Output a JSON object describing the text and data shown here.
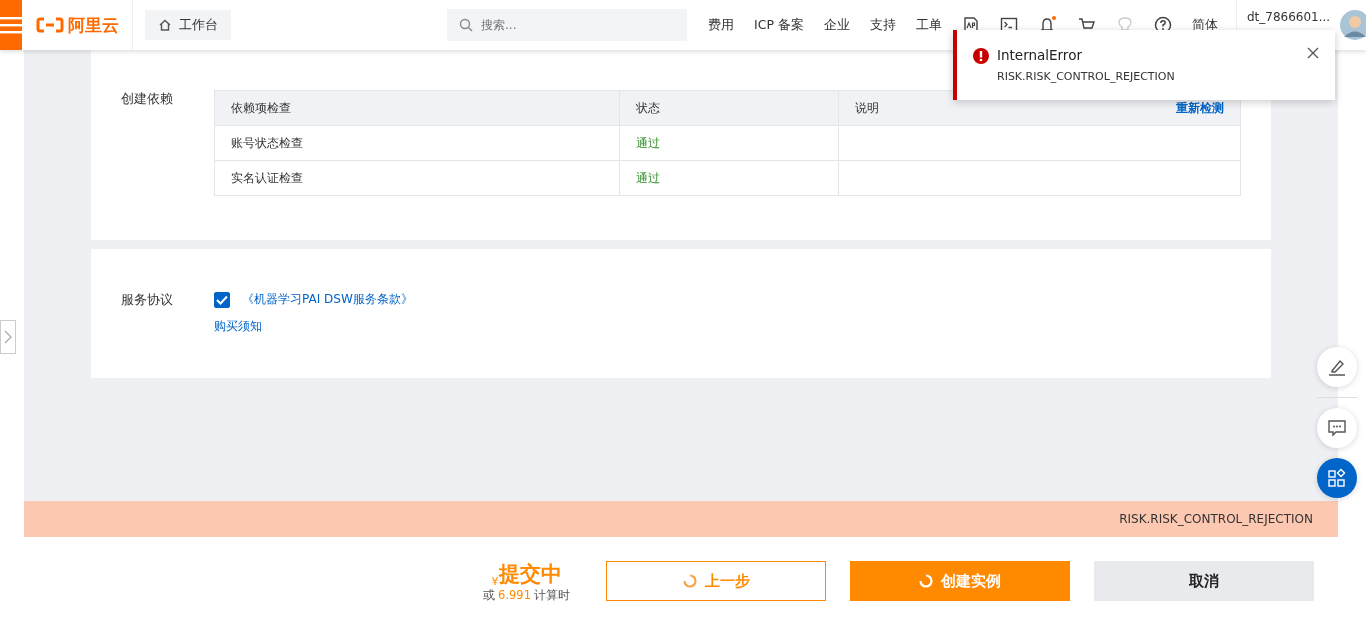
{
  "header": {
    "logo": "阿里云",
    "workbench": "工作台",
    "search": {
      "placeholder": "搜索..."
    },
    "nav": [
      "费用",
      "ICP 备案",
      "企业",
      "支持",
      "工单"
    ],
    "language": "简体",
    "user": "dt_7866601..."
  },
  "toast": {
    "title": "InternalError",
    "message": "RISK.RISK_CONTROL_REJECTION"
  },
  "dependencies": {
    "label": "创建依赖",
    "columns": [
      "依赖项检查",
      "状态",
      "说明"
    ],
    "recheck": "重新检测",
    "rows": [
      {
        "name": "账号状态检查",
        "status": "通过",
        "note": ""
      },
      {
        "name": "实名认证检查",
        "status": "通过",
        "note": ""
      }
    ]
  },
  "agreement": {
    "label": "服务协议",
    "checked": true,
    "link": "《机器学习PAI DSW服务条款》",
    "notice": "购买须知"
  },
  "error_bar": "RISK.RISK_CONTROL_REJECTION",
  "price": {
    "currency": "¥",
    "status": "提交中",
    "prefix": "或",
    "amount": "6.991",
    "unit": "计算时"
  },
  "buttons": [
    {
      "label": "上一步",
      "kind": "outline",
      "loading": true
    },
    {
      "label": "创建实例",
      "kind": "primary",
      "loading": true
    },
    {
      "label": "取消",
      "kind": "plain",
      "loading": false
    }
  ]
}
